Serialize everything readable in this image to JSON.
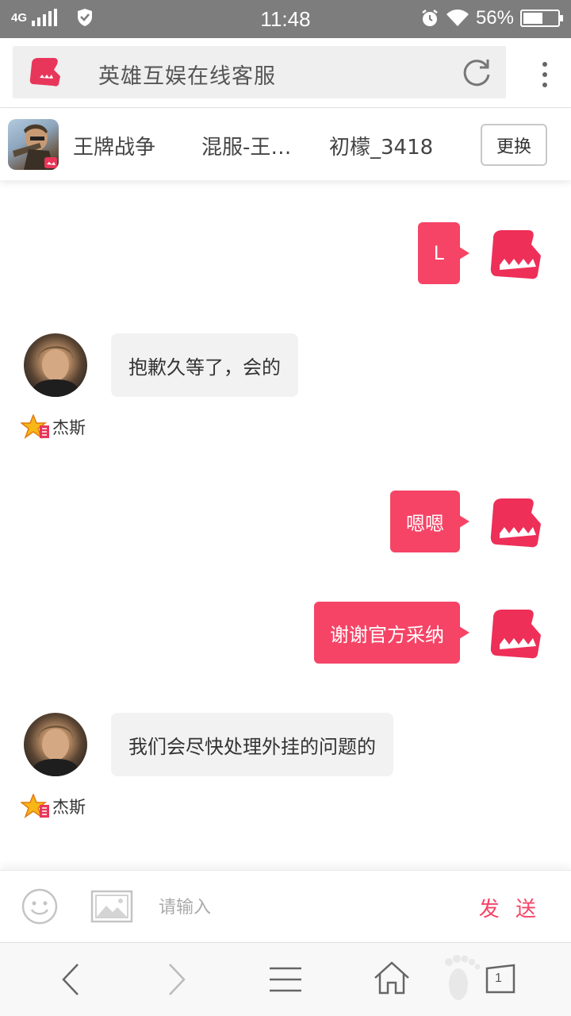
{
  "status_bar": {
    "network": "4G",
    "time": "11:48",
    "battery": "56%",
    "battery_level": 0.56
  },
  "address_bar": {
    "title": "英雄互娱在线客服"
  },
  "game_bar": {
    "game_name": "王牌战争",
    "server": "混服-王…",
    "role": "初檬_3418",
    "change_label": "更换"
  },
  "chat": {
    "messages": [
      {
        "from": "me",
        "text": "L"
      },
      {
        "from": "agent",
        "text": "抱歉久等了，会的",
        "name": "杰斯"
      },
      {
        "from": "me",
        "text": "嗯嗯"
      },
      {
        "from": "me",
        "text": "谢谢官方采纳"
      },
      {
        "from": "agent",
        "text": "我们会尽快处理外挂的问题的",
        "name": "杰斯"
      }
    ]
  },
  "input_bar": {
    "placeholder": "请输入",
    "send_label": "发 送"
  },
  "nav_bar": {
    "tab_count": "1"
  },
  "colors": {
    "accent": "#f54466",
    "status_bar": "#7d7d7d"
  }
}
